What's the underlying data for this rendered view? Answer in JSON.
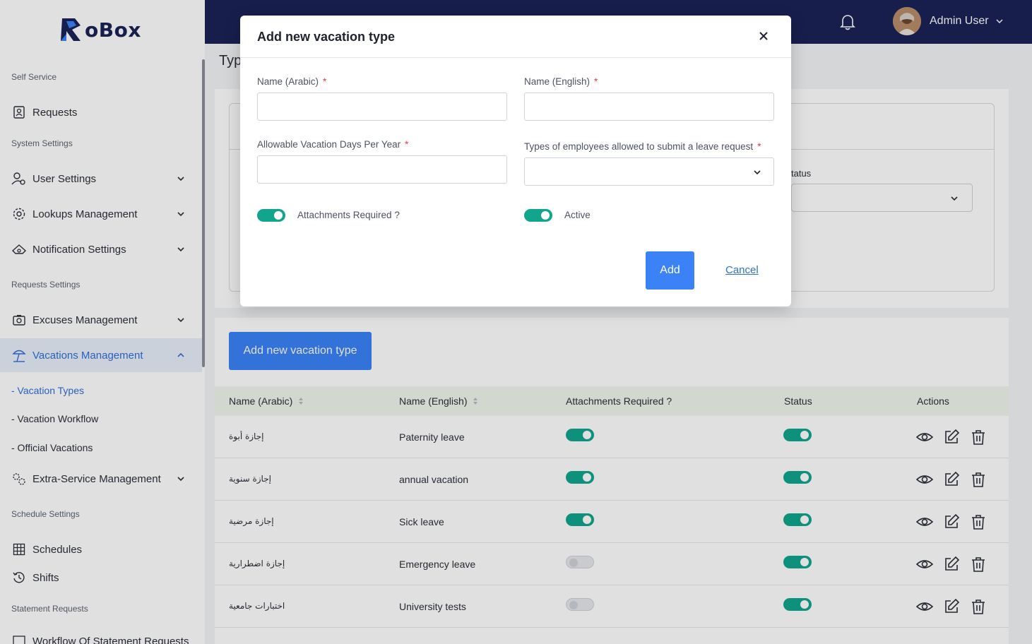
{
  "brand": {
    "logo_text": "oBox"
  },
  "sidebar": {
    "sections": {
      "self_service": "Self Service",
      "system_settings": "System Settings",
      "requests_settings": "Requests Settings",
      "schedule_settings": "Schedule Settings",
      "statement_requests": "Statement Requests"
    },
    "items": {
      "requests": "Requests",
      "user_settings": "User Settings",
      "lookups": "Lookups Management",
      "notifications": "Notification Settings",
      "excuses": "Excuses Management",
      "vacations": "Vacations Management",
      "extra_service": "Extra-Service Management",
      "schedules": "Schedules",
      "shifts": "Shifts",
      "workflow_statement": "Workflow Of Statement Requests"
    },
    "sub_items": {
      "vacation_types": "-  Vacation Types",
      "vacation_workflow": "-  Vacation Workflow",
      "official_vacations": "-  Official Vacations"
    }
  },
  "header": {
    "user_name": "Admin User"
  },
  "page": {
    "title_partial": "Typ",
    "filter_status_label": "tatus",
    "add_button": "Add new vacation type"
  },
  "table": {
    "headers": {
      "name_ar": "Name (Arabic)",
      "name_en": "Name (English)",
      "attachments": "Attachments Required ?",
      "status": "Status",
      "actions": "Actions"
    },
    "rows": [
      {
        "name_ar": "إجازة أبوة",
        "name_en": "Paternity leave",
        "attachments": true,
        "status": true
      },
      {
        "name_ar": "إجازة سنوية",
        "name_en": "annual vacation",
        "attachments": true,
        "status": true
      },
      {
        "name_ar": "إجازة مرضية",
        "name_en": "Sick leave",
        "attachments": true,
        "status": true
      },
      {
        "name_ar": "إجازة اضطرارية",
        "name_en": "Emergency leave",
        "attachments": false,
        "status": true
      },
      {
        "name_ar": "اختبارات جامعية",
        "name_en": "University tests",
        "attachments": false,
        "status": true
      }
    ]
  },
  "modal": {
    "title": "Add new vacation type",
    "fields": {
      "name_ar_label": "Name (Arabic)",
      "name_en_label": "Name (English)",
      "days_label": "Allowable Vacation Days Per Year",
      "types_label": "Types of employees allowed to submit a leave request",
      "required_mark": "*"
    },
    "toggles": {
      "attachments_label": "Attachments Required ?",
      "attachments_on": true,
      "active_label": "Active",
      "active_on": true
    },
    "add_label": "Add",
    "cancel_label": "Cancel"
  },
  "colors": {
    "header_bg": "#1b2356",
    "primary": "#3b82f6",
    "toggle_on": "#11a58e",
    "sidebar_active": "#2f6fd6"
  }
}
